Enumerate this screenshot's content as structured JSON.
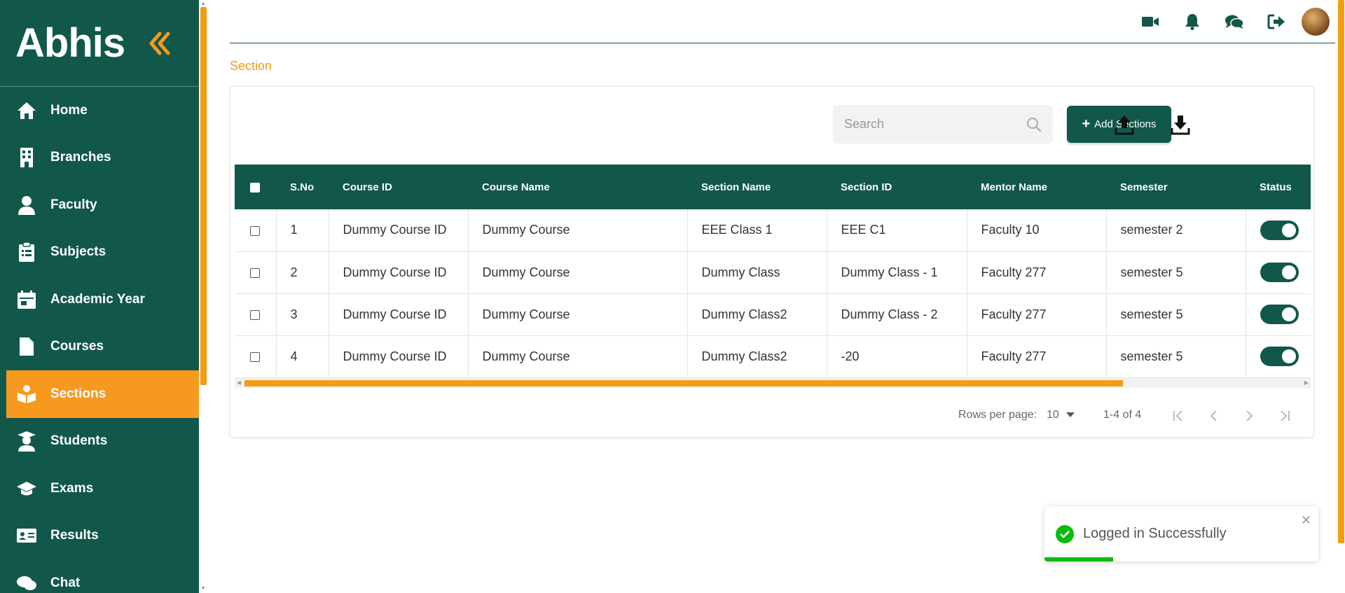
{
  "app": {
    "logo": "Abhis"
  },
  "sidebar": {
    "items": [
      {
        "label": "Home",
        "icon": "home-icon",
        "active": false
      },
      {
        "label": "Branches",
        "icon": "building-icon",
        "active": false
      },
      {
        "label": "Faculty",
        "icon": "user-icon",
        "active": false
      },
      {
        "label": "Subjects",
        "icon": "clipboard-icon",
        "active": false
      },
      {
        "label": "Academic Year",
        "icon": "calendar-icon",
        "active": false
      },
      {
        "label": "Courses",
        "icon": "file-icon",
        "active": false
      },
      {
        "label": "Sections",
        "icon": "book-reader-icon",
        "active": true
      },
      {
        "label": "Students",
        "icon": "graduate-icon",
        "active": false
      },
      {
        "label": "Exams",
        "icon": "graduation-cap-icon",
        "active": false
      },
      {
        "label": "Results",
        "icon": "id-card-icon",
        "active": false
      },
      {
        "label": "Chat",
        "icon": "chat-icon",
        "active": false
      }
    ]
  },
  "topbar": {
    "icons": [
      "video-icon",
      "bell-icon",
      "comments-icon",
      "logout-icon"
    ]
  },
  "breadcrumb": "Section",
  "toolbar": {
    "search_placeholder": "Search",
    "add_label": "Add Sections",
    "upload_icon": "upload-icon",
    "download_icon": "download-icon"
  },
  "table": {
    "headers": [
      "S.No",
      "Course ID",
      "Course Name",
      "Section Name",
      "Section ID",
      "Mentor Name",
      "Semester",
      "Status"
    ],
    "rows": [
      {
        "sno": "1",
        "course_id": "Dummy Course ID",
        "course_name": "Dummy Course",
        "section_name": "EEE Class 1",
        "section_id": "EEE C1",
        "mentor": "Faculty 10",
        "semester": "semester 2",
        "status": true
      },
      {
        "sno": "2",
        "course_id": "Dummy Course ID",
        "course_name": "Dummy Course",
        "section_name": "Dummy Class",
        "section_id": "Dummy Class - 1",
        "mentor": "Faculty 277",
        "semester": "semester 5",
        "status": true
      },
      {
        "sno": "3",
        "course_id": "Dummy Course ID",
        "course_name": "Dummy Course",
        "section_name": "Dummy Class2",
        "section_id": "Dummy Class - 2",
        "mentor": "Faculty 277",
        "semester": "semester 5",
        "status": true
      },
      {
        "sno": "4",
        "course_id": "Dummy Course ID",
        "course_name": "Dummy Course",
        "section_name": "Dummy Class2",
        "section_id": "-20",
        "mentor": "Faculty 277",
        "semester": "semester 5",
        "status": true
      }
    ]
  },
  "pagination": {
    "rows_label": "Rows per page:",
    "rows_value": "10",
    "range": "1-4 of 4"
  },
  "toast": {
    "message": "Logged in Successfully",
    "progress": 0.25
  },
  "colors": {
    "primary": "#11584a",
    "accent": "#f7981f",
    "success": "#07bc0c"
  }
}
